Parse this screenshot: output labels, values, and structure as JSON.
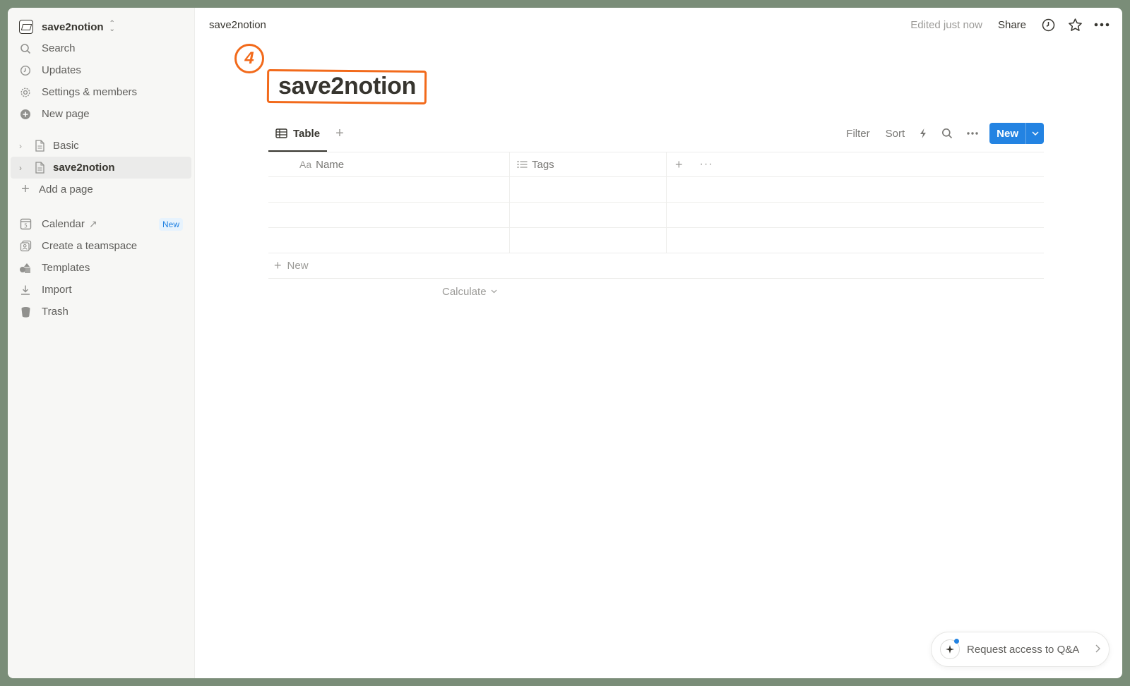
{
  "sidebar": {
    "workspace_name": "save2notion",
    "top_items": [
      {
        "label": "Search",
        "icon": "search-icon"
      },
      {
        "label": "Updates",
        "icon": "clock-icon"
      },
      {
        "label": "Settings & members",
        "icon": "gear-icon"
      },
      {
        "label": "New page",
        "icon": "plus-circle-icon"
      }
    ],
    "pages": [
      {
        "label": "Basic",
        "active": false
      },
      {
        "label": "save2notion",
        "active": true
      }
    ],
    "add_page_label": "Add a page",
    "bottom_items": [
      {
        "label": "Calendar",
        "icon": "calendar-icon",
        "badge": "New"
      },
      {
        "label": "Create a teamspace",
        "icon": "teamspace-icon"
      },
      {
        "label": "Templates",
        "icon": "templates-icon"
      },
      {
        "label": "Import",
        "icon": "import-icon"
      },
      {
        "label": "Trash",
        "icon": "trash-icon"
      }
    ]
  },
  "topbar": {
    "breadcrumb": "save2notion",
    "edited": "Edited just now",
    "share_label": "Share"
  },
  "page": {
    "title": "save2notion",
    "annotation_number": "4",
    "annotation_color": "#f26a1b"
  },
  "database": {
    "view_tab_label": "Table",
    "filter_label": "Filter",
    "sort_label": "Sort",
    "new_button_label": "New",
    "columns": [
      {
        "label": "Name",
        "icon_text": "Aa"
      },
      {
        "label": "Tags",
        "icon": "list-icon"
      }
    ],
    "new_row_label": "New",
    "calculate_label": "Calculate",
    "accent_color": "#2383e2"
  },
  "qa": {
    "label": "Request access to Q&A"
  }
}
